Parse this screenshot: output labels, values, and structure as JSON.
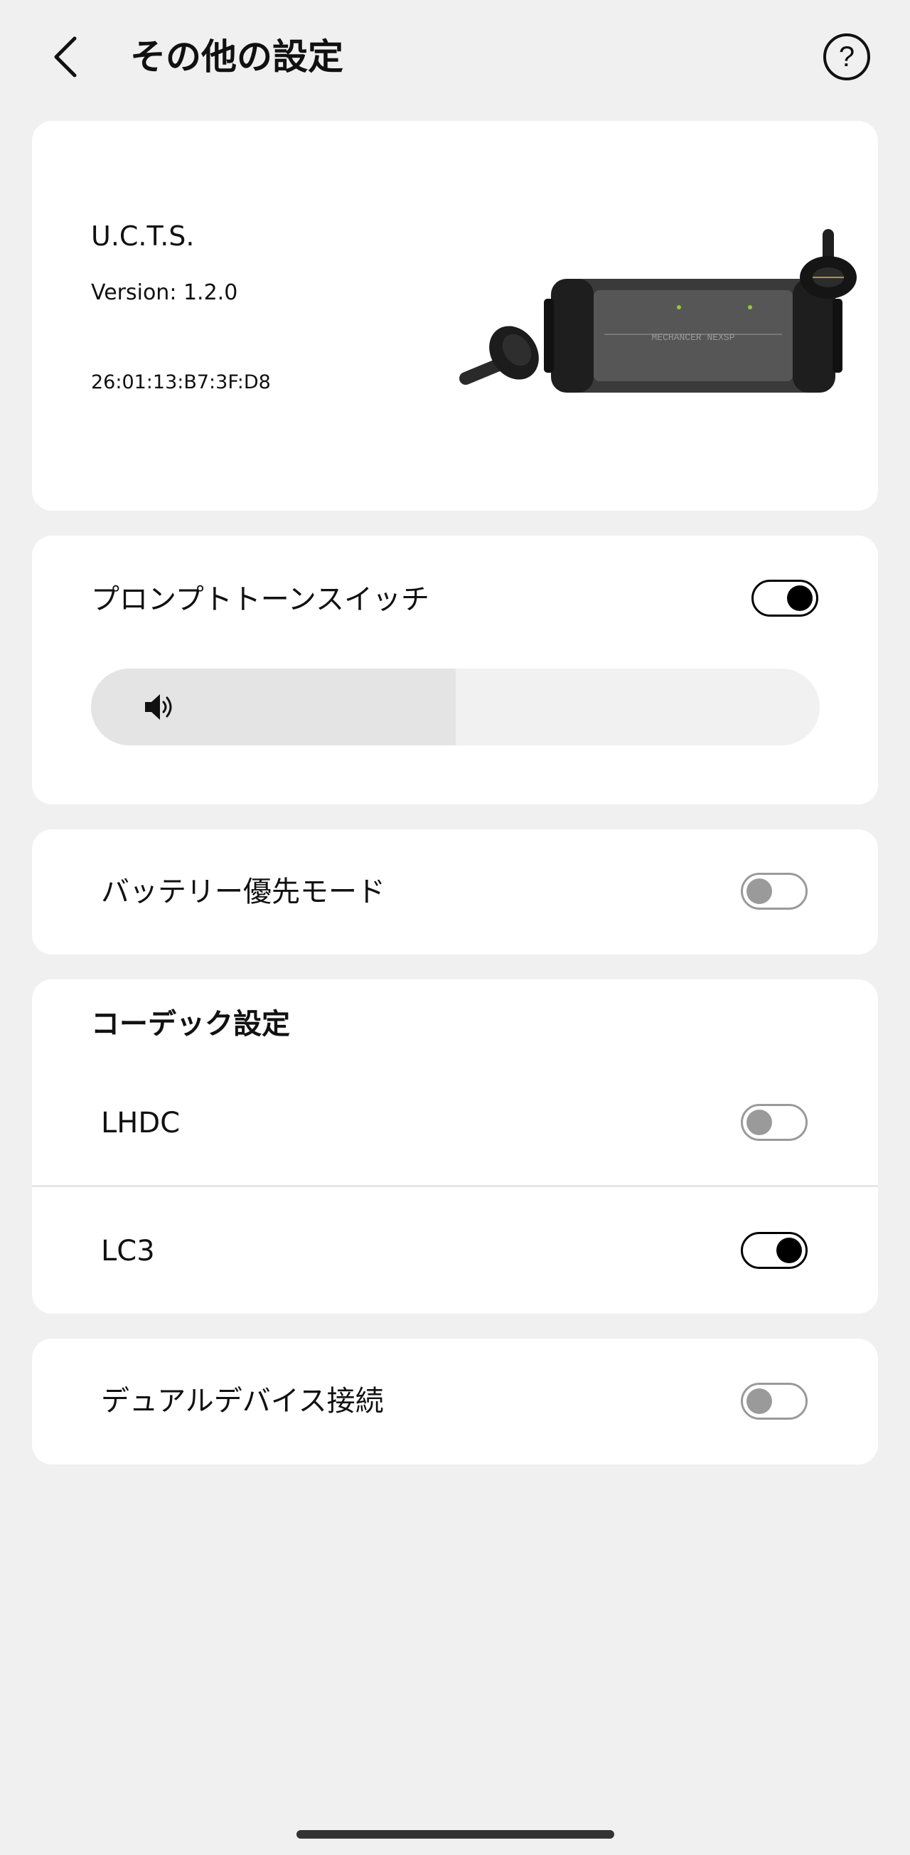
{
  "header": {
    "title": "その他の設定",
    "back_icon": "chevron-left-icon",
    "help_icon": "question-circle-icon"
  },
  "device": {
    "name": "U.C.T.S.",
    "version": "Version: 1.2.0",
    "mac": "26:01:13:B7:3F:D8"
  },
  "prompt_tone": {
    "label": "プロンプトトーンスイッチ",
    "enabled": true,
    "volume_fraction": 0.5,
    "volume_icon": "speaker-icon"
  },
  "battery_priority": {
    "label": "バッテリー優先モード",
    "enabled": false
  },
  "codec": {
    "title": "コーデック設定",
    "options": [
      {
        "label": "LHDC",
        "enabled": false
      },
      {
        "label": "LC3",
        "enabled": true
      }
    ]
  },
  "dual_device": {
    "label": "デュアルデバイス接続",
    "enabled": false
  },
  "colors": {
    "background": "#f0f0f0",
    "card": "#ffffff",
    "toggle_on": "#000000",
    "toggle_off": "#9a9a9a"
  }
}
